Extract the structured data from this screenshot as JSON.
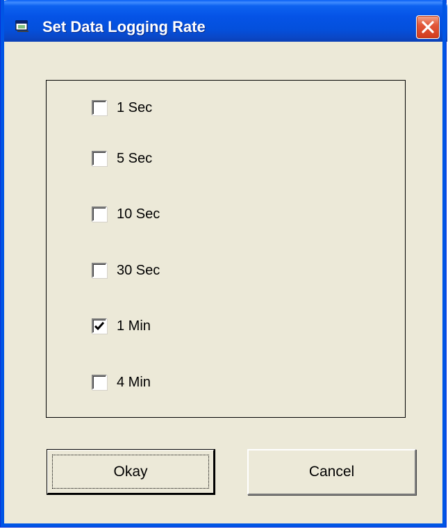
{
  "window": {
    "title": "Set Data Logging Rate"
  },
  "options": [
    {
      "label": "1 Sec",
      "checked": false
    },
    {
      "label": "5 Sec",
      "checked": false
    },
    {
      "label": "10 Sec",
      "checked": false
    },
    {
      "label": "30 Sec",
      "checked": false
    },
    {
      "label": "1 Min",
      "checked": true
    },
    {
      "label": "4 Min",
      "checked": false
    }
  ],
  "buttons": {
    "okay_label": "Okay",
    "cancel_label": "Cancel"
  },
  "icons": {
    "app": "app-window-icon",
    "close": "close-icon",
    "check": "checkmark-icon"
  },
  "colors": {
    "titlebar": "#0553e6",
    "dialog_bg": "#ece9d8",
    "close_button": "#d23a1c"
  }
}
